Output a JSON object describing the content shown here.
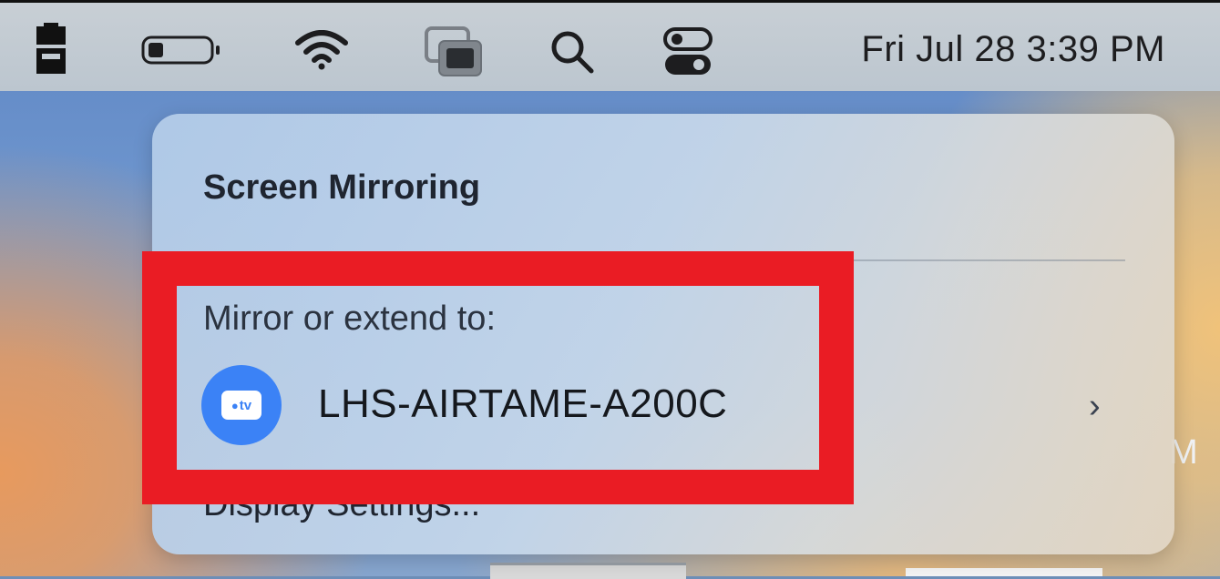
{
  "menubar": {
    "icons": [
      "finder-tray-icon",
      "battery-icon",
      "wifi-icon",
      "screen-mirroring-icon",
      "spotlight-search-icon",
      "control-center-icon"
    ],
    "clock": "Fri Jul 28  3:39 PM"
  },
  "popover": {
    "title": "Screen Mirroring",
    "section_label": "Mirror or extend to:",
    "device": {
      "icon": "apple-tv-icon",
      "badge": "tv",
      "name": "LHS-AIRTAME-A200C",
      "chevron": "›"
    },
    "footer": "Display Settings..."
  },
  "background": {
    "partial_text": "M"
  },
  "colors": {
    "highlight": "#ea1c24",
    "device_icon": "#3b82f6"
  }
}
